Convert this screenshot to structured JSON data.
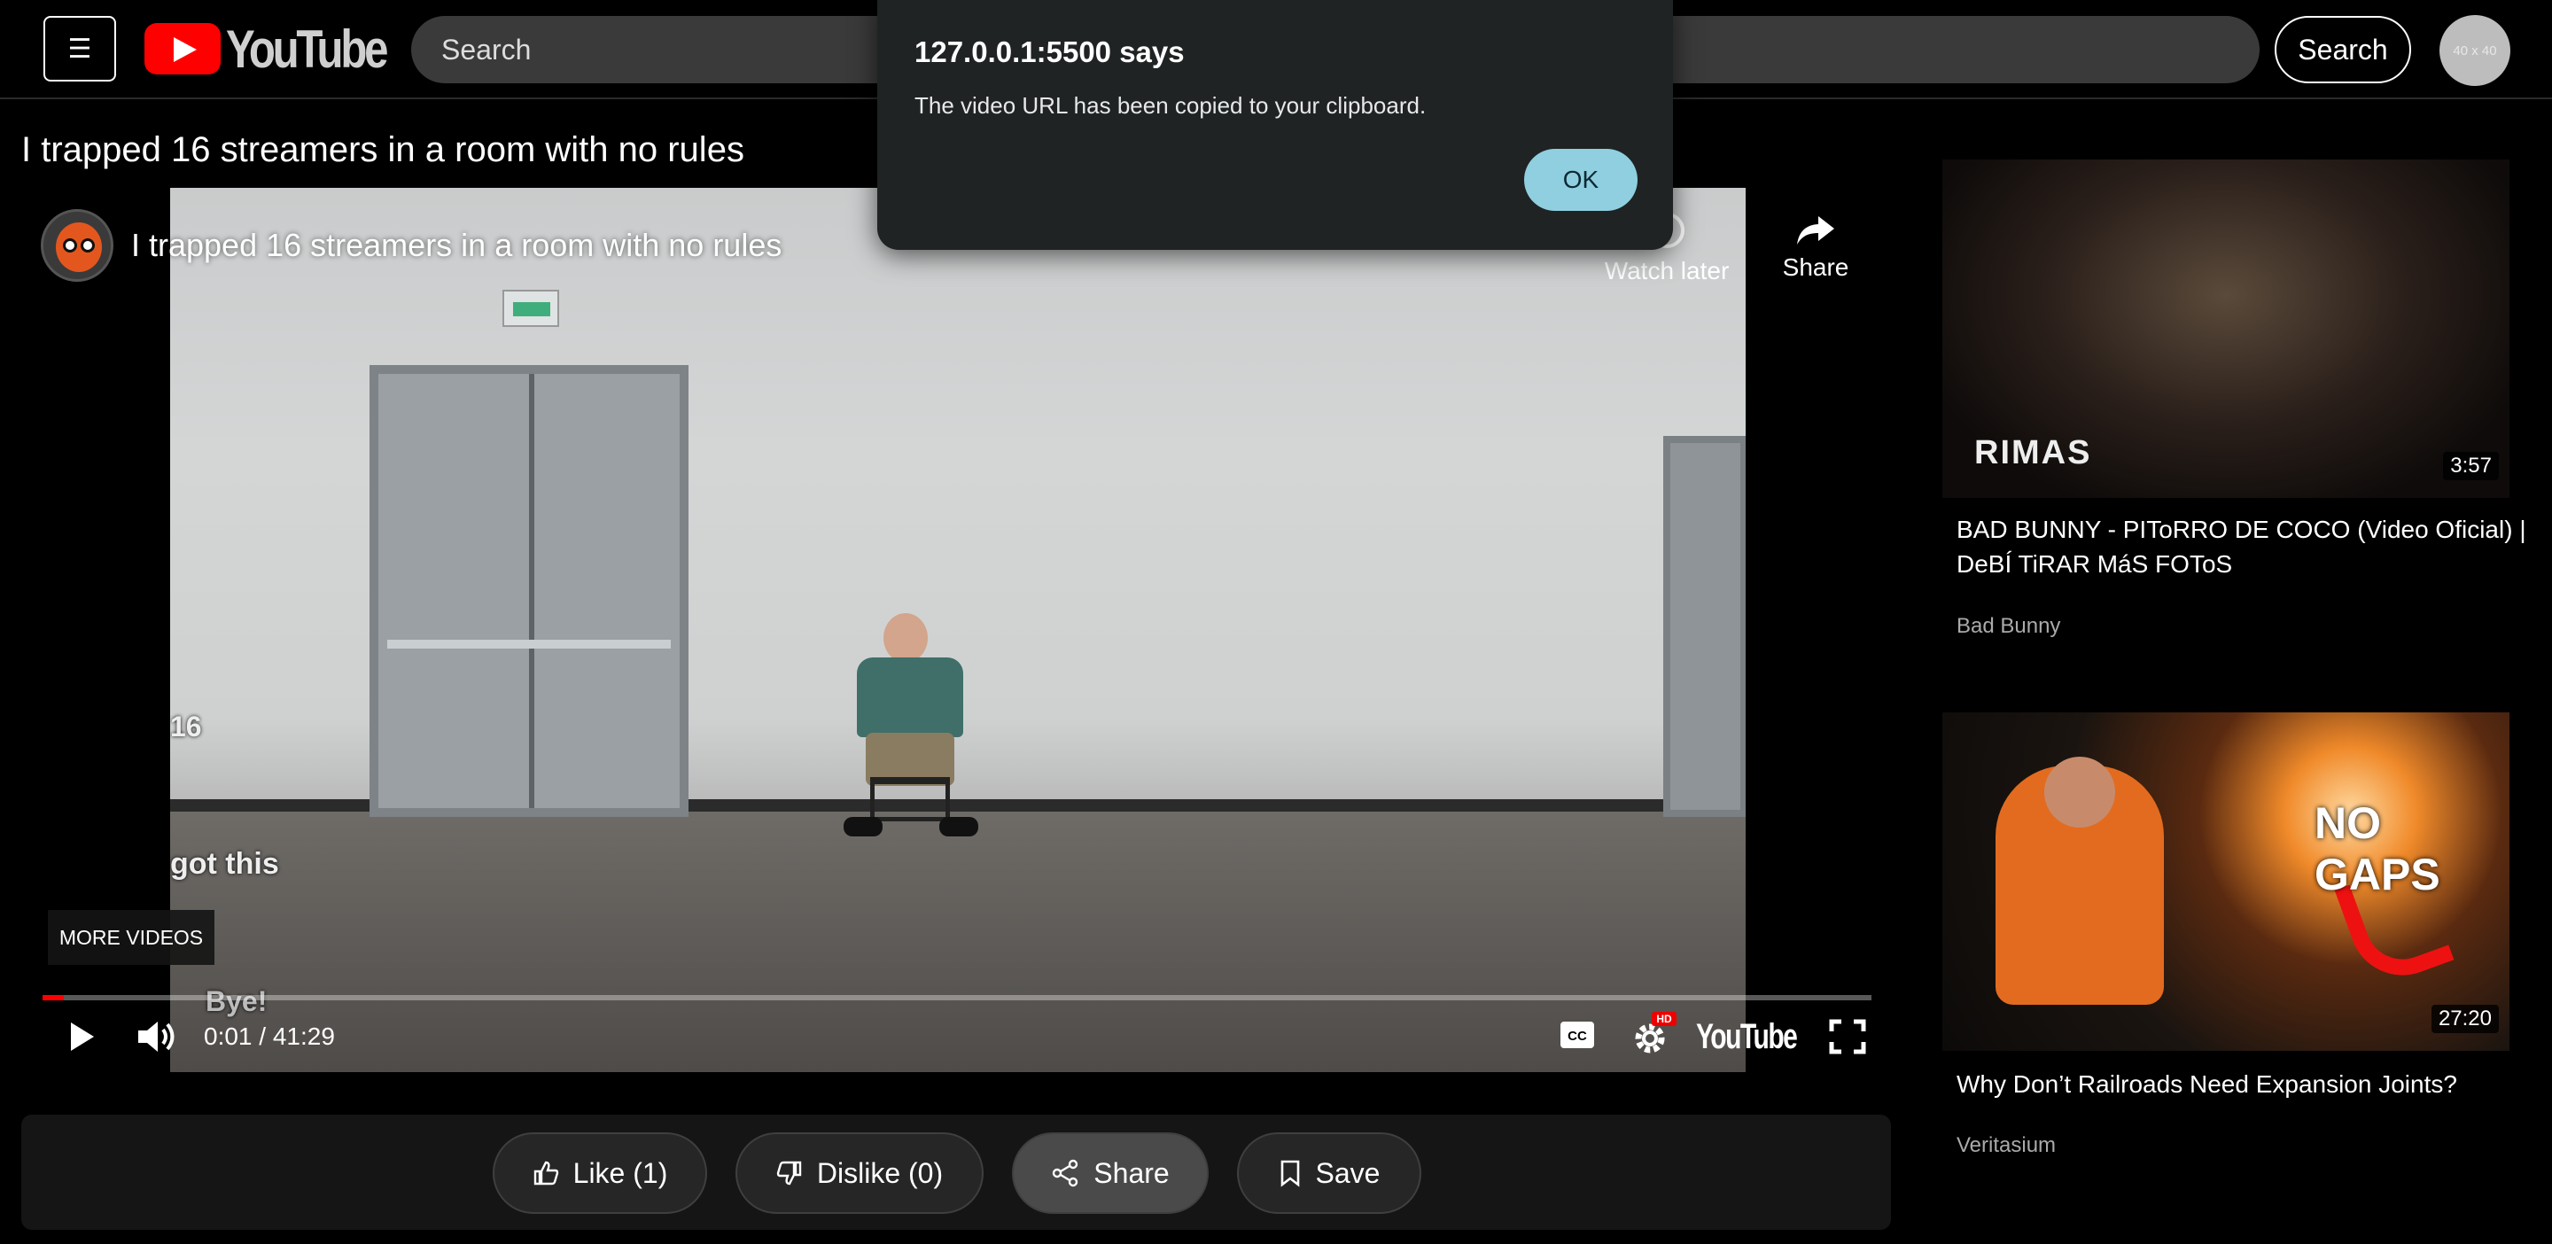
{
  "header": {
    "logo_text": "YouTube",
    "search_placeholder": "Search",
    "search_button": "Search",
    "avatar_text": "40 x 40"
  },
  "video": {
    "title": "I trapped 16 streamers in a room with no rules",
    "player_title": "I trapped 16 streamers in a room with no rules",
    "watch_later": "Watch later",
    "share": "Share",
    "more_videos": "MORE VIDEOS",
    "time": "0:01 / 41:29",
    "progress_fraction": 0.0004,
    "overlay_counter": "16",
    "overlay_caption1": "got this",
    "overlay_caption2": "Bye!",
    "brand_word": "YouTube",
    "hd_badge": "HD"
  },
  "actions": {
    "like": "Like (1)",
    "dislike": "Dislike (0)",
    "share": "Share",
    "save": "Save"
  },
  "sidebar": {
    "items": [
      {
        "title": "BAD BUNNY - PIToRRO DE COCO (Video Oficial) | DeBÍ TiRAR MáS FOToS",
        "channel": "Bad Bunny",
        "duration": "3:57",
        "thumb_text": "RIMAS"
      },
      {
        "title": "Why Don’t Railroads Need Expansion Joints?",
        "channel": "Veritasium",
        "duration": "27:20",
        "thumb_text": "NO GAPS"
      }
    ]
  },
  "dialog": {
    "title": "127.0.0.1:5500 says",
    "message": "The video URL has been copied to your clipboard.",
    "ok": "OK"
  },
  "colors": {
    "brand_red": "#ff0000",
    "dialog_ok": "#8fcfe0",
    "background": "#000000"
  }
}
